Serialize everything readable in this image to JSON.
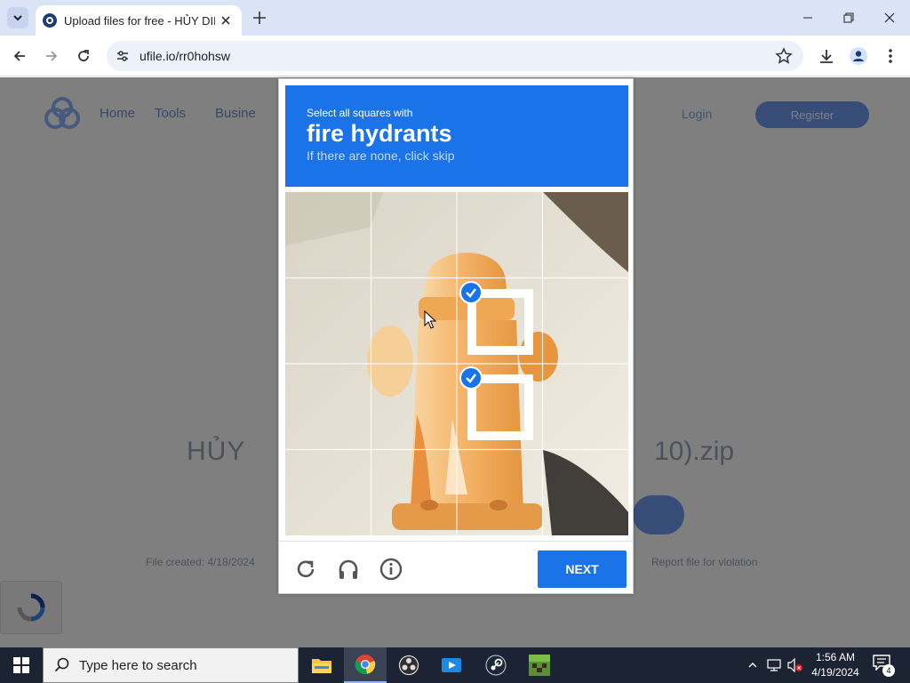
{
  "browser": {
    "tab_title": "Upload files for free - HỦY DIỆ",
    "url": "ufile.io/rr0hohsw",
    "icons": {
      "tab_search": "chevron-down-icon",
      "tab_close": "close-icon",
      "new_tab": "plus-icon",
      "back": "arrow-left-icon",
      "forward": "arrow-right-icon",
      "reload": "reload-icon",
      "site_info": "tune-icon",
      "bookmark": "star-icon",
      "download": "download-icon",
      "profile": "profile-icon",
      "menu": "kebab-menu-icon"
    }
  },
  "page": {
    "nav": [
      "Home",
      "Tools",
      "Business"
    ],
    "login": "Login",
    "register": "Register",
    "file_name_left": "HỦY",
    "file_name_right": "10).zip",
    "created": "File created: 4/18/2024",
    "report": "Report file for violation"
  },
  "captcha": {
    "instruction": "Select all squares with",
    "target": "fire hydrants",
    "hint": "If there are none, click skip",
    "next_label": "NEXT",
    "grid_size": 4,
    "selected_tiles": [
      6,
      10
    ],
    "footer_icons": [
      "reload-icon",
      "headphones-icon",
      "info-icon"
    ],
    "colors": {
      "header_bg": "#1a73e8",
      "button_bg": "#1a73e8",
      "hydrant": "#f2a857",
      "sidewalk": "#e9e4d7"
    }
  },
  "taskbar": {
    "search_placeholder": "Type here to search",
    "time": "1:56 AM",
    "date": "4/19/2024",
    "notifications": "4",
    "apps": [
      "file-explorer-icon",
      "chrome-icon",
      "obs-icon",
      "media-player-icon",
      "steam-icon",
      "minecraft-icon"
    ]
  }
}
